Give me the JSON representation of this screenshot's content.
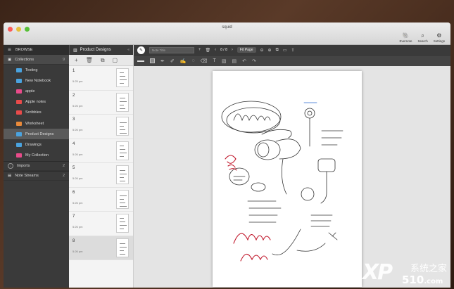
{
  "window": {
    "title": "squid",
    "actions": [
      {
        "label": "Evernote",
        "icon": "evernote-icon",
        "glyph": "🐘"
      },
      {
        "label": "Search",
        "icon": "search-icon",
        "glyph": "⌕"
      },
      {
        "label": "Settings",
        "icon": "gear-icon",
        "glyph": "⚙"
      }
    ]
  },
  "sidebar": {
    "browse_label": "BROWSE",
    "collections": {
      "label": "Collections",
      "count": "9"
    },
    "items": [
      {
        "label": "Testing",
        "color": "#4aa3df"
      },
      {
        "label": "New Notebook",
        "color": "#4aa3df"
      },
      {
        "label": "apple",
        "color": "#e94b8a"
      },
      {
        "label": "Apple notes",
        "color": "#e94b4b"
      },
      {
        "label": "Scribbles",
        "color": "#e94b4b"
      },
      {
        "label": "Worksheet",
        "color": "#e98a3a"
      },
      {
        "label": "Product Designs",
        "color": "#4aa3df"
      },
      {
        "label": "Drawings",
        "color": "#4aa3df"
      },
      {
        "label": "My Collection",
        "color": "#e94b8a"
      }
    ],
    "imports": {
      "label": "Imports",
      "count": "2"
    },
    "note_streams": {
      "label": "Note Streams",
      "count": "2"
    }
  },
  "notelist": {
    "title": "Product Designs",
    "pages": [
      {
        "num": "1",
        "time": "5:25 pm"
      },
      {
        "num": "2",
        "time": "5:26 pm"
      },
      {
        "num": "3",
        "time": "5:26 pm"
      },
      {
        "num": "4",
        "time": "5:26 pm"
      },
      {
        "num": "5",
        "time": "5:26 pm"
      },
      {
        "num": "6",
        "time": "5:26 pm"
      },
      {
        "num": "7",
        "time": "5:26 pm"
      },
      {
        "num": "8",
        "time": "5:26 pm"
      }
    ],
    "active_index": 7
  },
  "editor": {
    "title_placeholder": "Note Title",
    "page_indicator": "8 / 8",
    "fit_label": "Fit Page"
  },
  "watermark": {
    "brand": "XP",
    "chinese": "系统之家",
    "site": "510",
    "tld": ".com"
  }
}
